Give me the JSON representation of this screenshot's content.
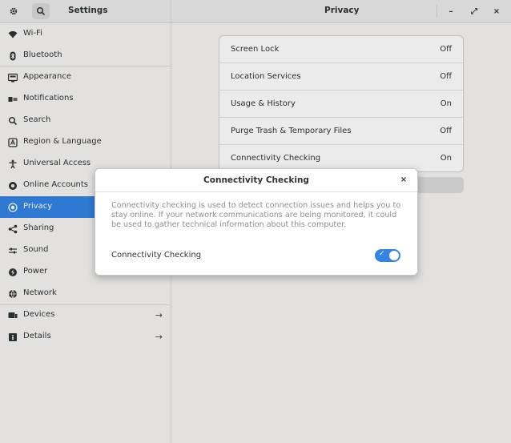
{
  "header": {
    "app_title": "Settings",
    "panel_title": "Privacy",
    "minimize_label": "–",
    "maximize_label": "⤢",
    "close_label": "×"
  },
  "sidebar": {
    "items": [
      {
        "label": "Wi-Fi",
        "icon": "wifi-icon"
      },
      {
        "label": "Bluetooth",
        "icon": "bluetooth-icon"
      },
      {
        "label": "Appearance",
        "icon": "appearance-icon"
      },
      {
        "label": "Notifications",
        "icon": "notifications-icon"
      },
      {
        "label": "Search",
        "icon": "search-icon"
      },
      {
        "label": "Region & Language",
        "icon": "region-icon"
      },
      {
        "label": "Universal Access",
        "icon": "accessibility-icon"
      },
      {
        "label": "Online Accounts",
        "icon": "online-accounts-icon"
      },
      {
        "label": "Privacy",
        "icon": "privacy-icon",
        "selected": true
      },
      {
        "label": "Sharing",
        "icon": "sharing-icon"
      },
      {
        "label": "Sound",
        "icon": "sound-icon"
      },
      {
        "label": "Power",
        "icon": "power-icon"
      },
      {
        "label": "Network",
        "icon": "network-icon"
      },
      {
        "label": "Devices",
        "icon": "devices-icon",
        "arrow": "→"
      },
      {
        "label": "Details",
        "icon": "details-icon",
        "arrow": "→"
      }
    ]
  },
  "privacy": {
    "rows": [
      {
        "label": "Screen Lock",
        "value": "Off"
      },
      {
        "label": "Location Services",
        "value": "Off"
      },
      {
        "label": "Usage & History",
        "value": "On"
      },
      {
        "label": "Purge Trash & Temporary Files",
        "value": "Off"
      },
      {
        "label": "Connectivity Checking",
        "value": "On"
      }
    ]
  },
  "dialog": {
    "title": "Connectivity Checking",
    "close_label": "×",
    "description": "Connectivity checking is used to detect connection issues and helps you to stay online. If your network communications are being monitored, it could be used to gather technical information about this computer.",
    "toggle_label": "Connectivity Checking",
    "toggle_on": true,
    "check_glyph": "✓"
  },
  "colors": {
    "accent": "#3584e4",
    "sidebar_bg": "#f6f5f4",
    "header_bg": "#ebebeb"
  }
}
